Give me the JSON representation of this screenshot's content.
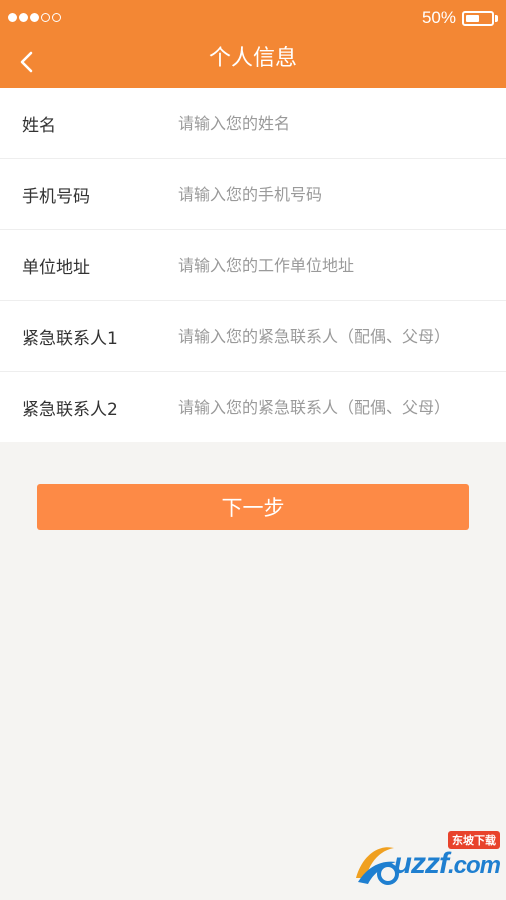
{
  "status_bar": {
    "battery_text": "50%",
    "signal_dots": [
      true,
      true,
      true,
      false,
      false
    ]
  },
  "nav": {
    "title": "个人信息",
    "back_icon": "chevron-left-icon"
  },
  "form": {
    "fields": [
      {
        "label": "姓名",
        "placeholder": "请输入您的姓名"
      },
      {
        "label": "手机号码",
        "placeholder": "请输入您的手机号码"
      },
      {
        "label": "单位地址",
        "placeholder": "请输入您的工作单位地址"
      },
      {
        "label": "紧急联系人1",
        "placeholder": "请输入您的紧急联系人（配偶、父母）"
      },
      {
        "label": "紧急联系人2",
        "placeholder": "请输入您的紧急联系人（配偶、父母）"
      }
    ]
  },
  "next_button": {
    "label": "下一步"
  },
  "watermark": {
    "text": "uzzf",
    "suffix": ".com",
    "tag": "东坡下载"
  },
  "colors": {
    "header": "#f38734",
    "button": "#fd8a46",
    "background": "#f5f4f2"
  }
}
